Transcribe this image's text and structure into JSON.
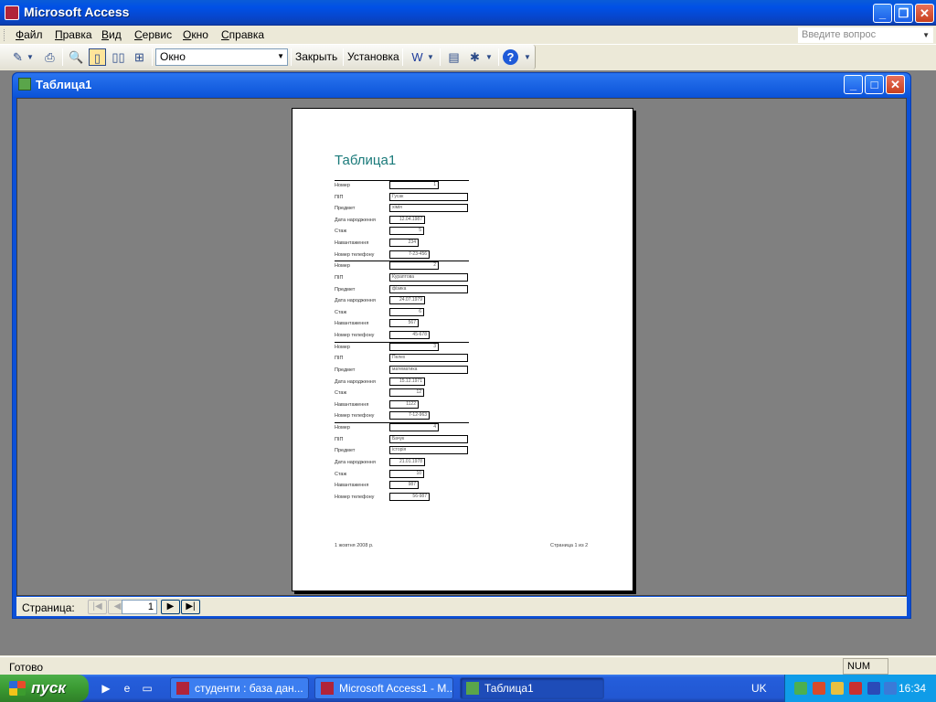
{
  "app": {
    "title": "Microsoft Access"
  },
  "menu": [
    "Файл",
    "Правка",
    "Вид",
    "Сервис",
    "Окно",
    "Справка"
  ],
  "help_box": {
    "placeholder": "Введите вопрос"
  },
  "toolbar": {
    "zoom_value": "Окно",
    "close_label": "Закрыть",
    "setup_label": "Установка",
    "icons": [
      "design-view-icon",
      "print-icon",
      "zoom-icon",
      "one-page-icon",
      "two-pages-icon",
      "multiple-pages-icon",
      "office-links-icon",
      "database-window-icon",
      "new-object-icon",
      "help-icon"
    ]
  },
  "doc_window": {
    "title": "Таблица1"
  },
  "report": {
    "title": "Таблица1",
    "footer_date": "1 жовтня 2008 р.",
    "footer_page": "Страница 1 из 2",
    "labels": [
      "Номер",
      "ПІП",
      "Предмет",
      "Дата народження",
      "Стаж",
      "Навантаження",
      "Номер телефону"
    ],
    "records": [
      {
        "Номер": "1",
        "ПІП": "Гусак",
        "Предмет": "хімія",
        "Дата народження": "12.04.1987",
        "Стаж": "5",
        "Навантаження": "234",
        "Номер телефону": "7-23-456"
      },
      {
        "Номер": "2",
        "ПІП": "Кураптова",
        "Предмет": "фізика",
        "Дата народження": "24.07.1979",
        "Стаж": "6",
        "Навантаження": "567",
        "Номер телефону": "45-678"
      },
      {
        "Номер": "3",
        "ПІП": "Пелех",
        "Предмет": "математика",
        "Дата народження": "15.12.1971",
        "Стаж": "12",
        "Навантаження": "1122",
        "Номер телефону": "7-12-963"
      },
      {
        "Номер": "4",
        "ПІП": "Бачук",
        "Предмет": "історія",
        "Дата народження": "21.01.1978",
        "Стаж": "10",
        "Навантаження": "987",
        "Номер телефону": "56-987"
      }
    ]
  },
  "nav": {
    "label": "Страница:",
    "page": "1"
  },
  "status": {
    "message": "Готово",
    "num": "NUM"
  },
  "taskbar": {
    "start": "пуск",
    "tasks": [
      "студенти : база дан...",
      "Microsoft Access1 - M...",
      "Таблица1"
    ],
    "lang": "UK",
    "clock": "16:34"
  },
  "colors": {
    "title_bar": "#0050e6",
    "report_title": "#1a7a7a",
    "taskbar": "#245edb",
    "start": "#3a9a32"
  }
}
